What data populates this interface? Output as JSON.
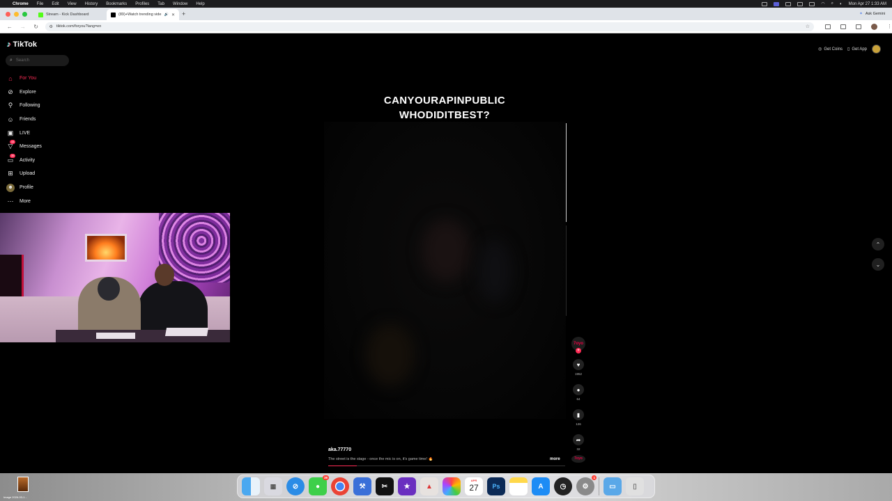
{
  "menubar": {
    "app": "Chrome",
    "items": [
      "File",
      "Edit",
      "View",
      "History",
      "Bookmarks",
      "Profiles",
      "Tab",
      "Window",
      "Help"
    ],
    "clock": "Mon Apr 27  1:33 AM"
  },
  "browser": {
    "tabs": [
      {
        "title": "Stream - Kick Dashboard",
        "active": false,
        "favicon_color": "#53fc18"
      },
      {
        "title": "(89)+Watch trending vide",
        "active": true,
        "favicon_color": "#000000"
      }
    ],
    "ask_gemini": "Ask Gemini",
    "url": "tiktok.com/foryou?lang=en"
  },
  "tiktok": {
    "brand": "TikTok",
    "search_placeholder": "Search",
    "nav": [
      {
        "label": "For You",
        "icon": "home-icon",
        "active": true
      },
      {
        "label": "Explore",
        "icon": "compass-icon",
        "active": false
      },
      {
        "label": "Following",
        "icon": "following-icon",
        "active": false
      },
      {
        "label": "Friends",
        "icon": "friends-icon",
        "active": false
      },
      {
        "label": "LIVE",
        "icon": "live-icon",
        "active": false
      },
      {
        "label": "Messages",
        "icon": "messages-icon",
        "active": false,
        "badge": "44"
      },
      {
        "label": "Activity",
        "icon": "activity-icon",
        "active": false,
        "badge": "35"
      },
      {
        "label": "Upload",
        "icon": "upload-icon",
        "active": false
      },
      {
        "label": "Profile",
        "icon": "profile-icon",
        "active": false
      },
      {
        "label": "More",
        "icon": "more-icon",
        "active": false
      }
    ],
    "get_coins": "Get Coins",
    "get_app": "Get App",
    "video": {
      "title_line1": "CANYOURAPINPUBLIC",
      "title_line2": "WHODIDITBEST?",
      "username": "aka.77770",
      "caption": "The street is the stage - once the mic is on, it's game time! 🔥",
      "more": "more",
      "progress": 0.12,
      "likes": "1952",
      "comments": "64",
      "saves": "126",
      "shares": "32",
      "avatar_text": "7oyo"
    }
  },
  "dock": {
    "calendar_month": "APR",
    "calendar_day": "27",
    "messages_badge": "38",
    "settings_badge": "1",
    "desktop_thumb_label": "Image 2026-03-1..."
  }
}
